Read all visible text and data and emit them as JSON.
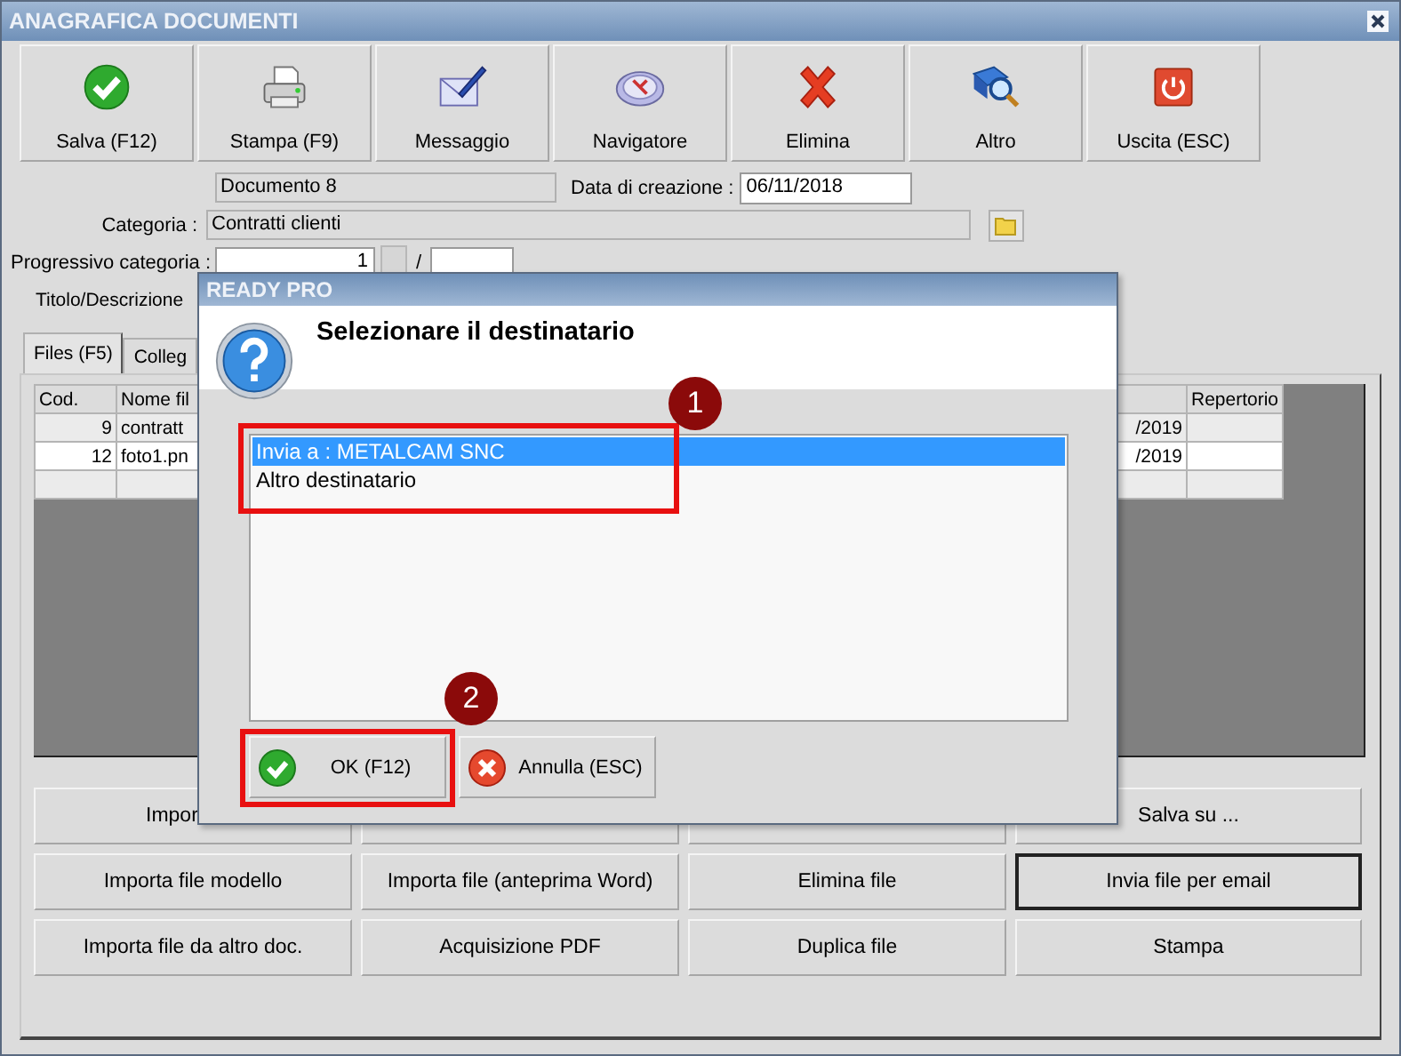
{
  "window": {
    "title": "ANAGRAFICA DOCUMENTI"
  },
  "toolbar": [
    {
      "label": "Salva (F12)",
      "kind": "check"
    },
    {
      "label": "Stampa (F9)",
      "kind": "printer"
    },
    {
      "label": "Messaggio",
      "kind": "envelope"
    },
    {
      "label": "Navigatore",
      "kind": "compass"
    },
    {
      "label": "Elimina",
      "kind": "cross"
    },
    {
      "label": "Altro",
      "kind": "book"
    },
    {
      "label": "Uscita (ESC)",
      "kind": "power"
    }
  ],
  "form": {
    "document_name": "Documento 8",
    "created_label": "Data di creazione :",
    "created_value": "06/11/2018",
    "category_label": "Categoria :",
    "category_value": "Contratti clienti",
    "progressive_label": "Progressivo categoria :",
    "progressive_value": "1",
    "progressive_separator": "/",
    "title_label": "Titolo/Descrizione"
  },
  "tabs": [
    {
      "label": "Files (F5)",
      "selected": true
    },
    {
      "label": "Colleg",
      "selected": false
    }
  ],
  "table": {
    "columns": [
      "Cod.",
      "Nome fil",
      "",
      "Repertorio"
    ],
    "rows": [
      {
        "cod": "9",
        "name": "contratt",
        "column_3": "/2019"
      },
      {
        "cod": "12",
        "name": "foto1.pn",
        "column_3": "/2019"
      },
      {}
    ]
  },
  "file_buttons": [
    {
      "label": "Impor",
      "kind": "partial",
      "focused": false
    },
    {
      "kind": "covered",
      "focused": false
    },
    {
      "kind": "covered",
      "focused": false
    },
    {
      "label": "Salva su ...",
      "kind": "plain",
      "focused": false
    },
    {
      "label": "Importa file modello",
      "kind": "plain",
      "focused": false
    },
    {
      "label": "Importa file (anteprima Word)",
      "kind": "plain",
      "focused": false
    },
    {
      "label": "Elimina file",
      "kind": "plain",
      "focused": false
    },
    {
      "label": "Invia file per email",
      "kind": "plain",
      "focused": true
    },
    {
      "label": "Importa file da altro doc.",
      "kind": "plain",
      "focused": false
    },
    {
      "label": "Acquisizione PDF",
      "kind": "plain",
      "focused": false
    },
    {
      "label": "Duplica file",
      "kind": "plain",
      "focused": false
    },
    {
      "label": "Stampa",
      "kind": "plain",
      "focused": false
    }
  ],
  "dialog": {
    "title": "READY PRO",
    "heading": "Selezionare il destinatario",
    "options": [
      {
        "label": "Invia a : METALCAM SNC",
        "selected": true
      },
      {
        "label": "Altro destinatario",
        "selected": false
      }
    ],
    "buttons": [
      {
        "label": "OK (F12)",
        "kind": "ok"
      },
      {
        "label": "Annulla (ESC)",
        "kind": "cancel"
      }
    ]
  },
  "annotations": [
    {
      "label": "1"
    },
    {
      "label": "2"
    }
  ]
}
